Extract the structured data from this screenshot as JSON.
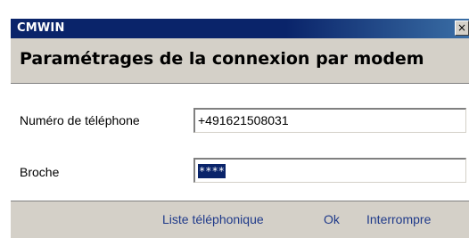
{
  "window": {
    "title": "CMWIN",
    "close_symbol": "×"
  },
  "header": {
    "title": "Paramétrages de la connexion par modem"
  },
  "form": {
    "phone": {
      "label": "Numéro de téléphone",
      "value": "+491621508031"
    },
    "pin": {
      "label": "Broche",
      "value": "****"
    }
  },
  "footer": {
    "phonebook_label": "Liste téléphonique",
    "ok_label": "Ok",
    "cancel_label": "Interrompre"
  },
  "colors": {
    "titlebar": "#0a246a",
    "dialog_bg": "#d4d0c8",
    "link": "#1f3a8a",
    "selection": "#0a246a"
  }
}
